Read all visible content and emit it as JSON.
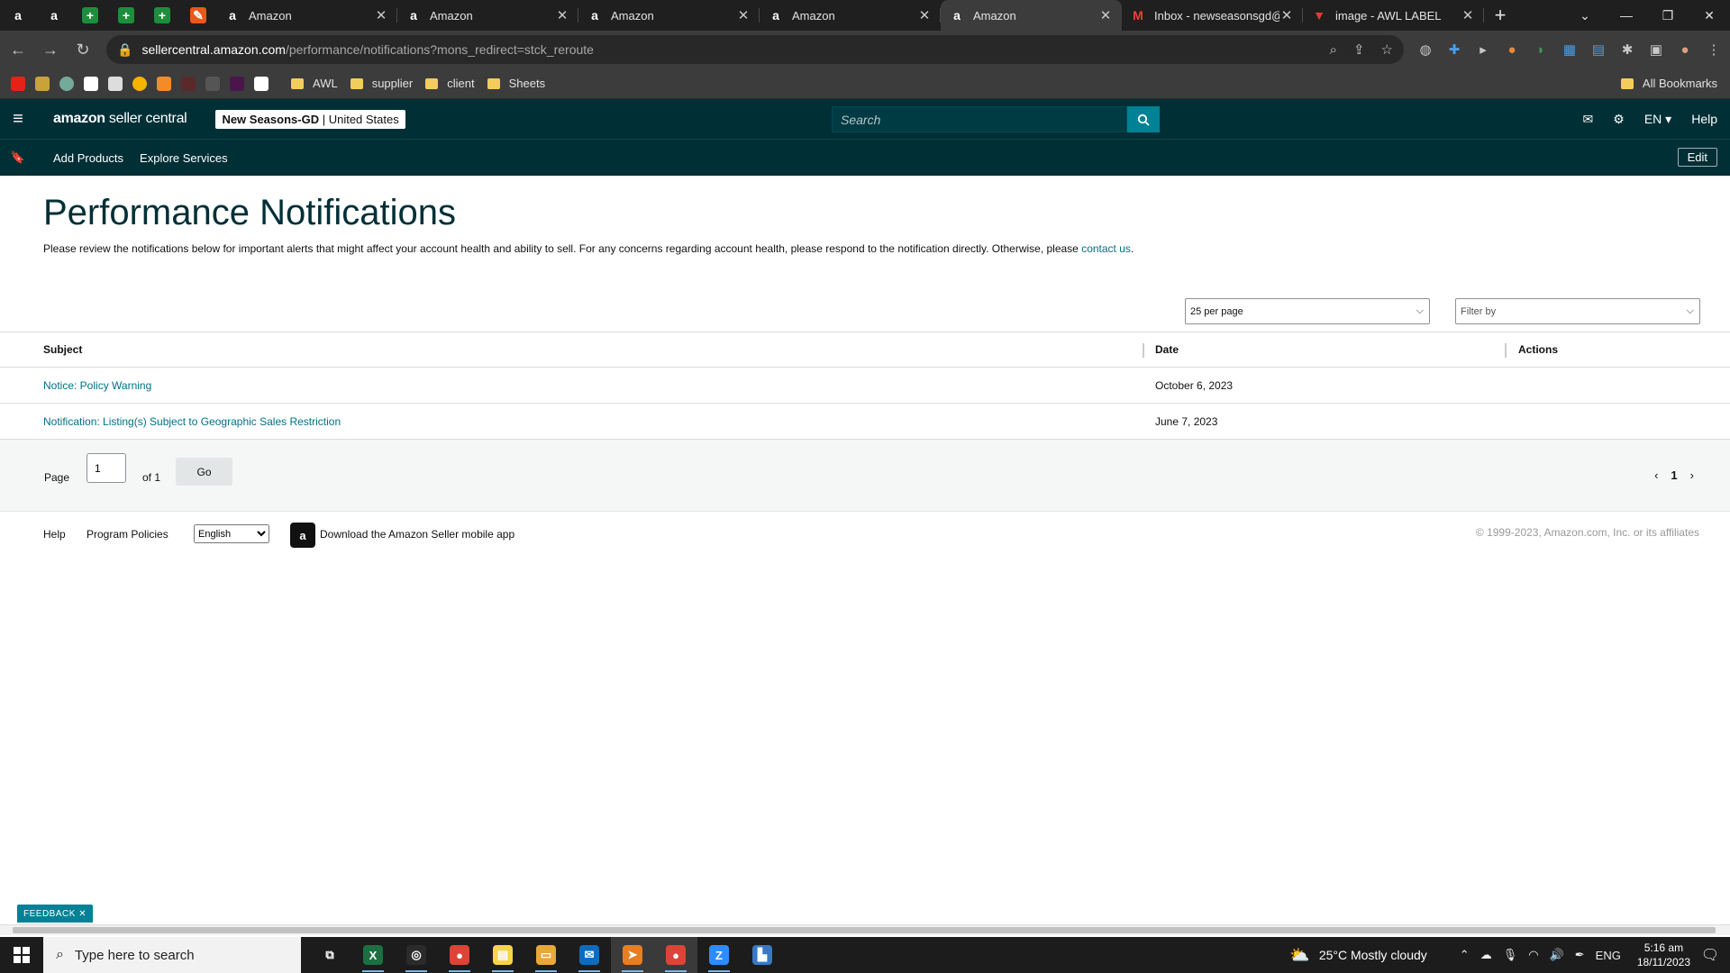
{
  "browser": {
    "pinned_tabs": [
      {
        "icon": "amazon-icon",
        "glyph": "a",
        "bg": "#1f1f1f",
        "fg": "#ffffff"
      },
      {
        "icon": "amazon-icon",
        "glyph": "a",
        "bg": "#1f1f1f",
        "fg": "#ffffff"
      },
      {
        "icon": "sheets-icon",
        "glyph": "+",
        "bg": "#1e8e3e",
        "fg": "#ffffff"
      },
      {
        "icon": "sheets-icon",
        "glyph": "+",
        "bg": "#1e8e3e",
        "fg": "#ffffff"
      },
      {
        "icon": "sheets-icon",
        "glyph": "+",
        "bg": "#1e8e3e",
        "fg": "#ffffff"
      },
      {
        "icon": "tool-icon",
        "glyph": "✎",
        "bg": "#e8591a",
        "fg": "#ffffff"
      }
    ],
    "tabs": [
      {
        "title": "Amazon",
        "active": false
      },
      {
        "title": "Amazon",
        "active": false
      },
      {
        "title": "Amazon",
        "active": false
      },
      {
        "title": "Amazon",
        "active": false
      },
      {
        "title": "Amazon",
        "active": true
      },
      {
        "title": "Inbox - newseasonsgd@",
        "active": false
      },
      {
        "title": "image - AWL LABEL",
        "active": false
      }
    ],
    "url_host": "sellercentral.amazon.com",
    "url_path": "/performance/notifications?mons_redirect=stck_reroute",
    "bookmarks": [
      "AWL",
      "supplier",
      "client",
      "Sheets"
    ],
    "all_bookmarks": "All Bookmarks"
  },
  "header": {
    "logo_bold": "amazon",
    "logo_rest": " seller central",
    "account_name": "New Seasons-GD",
    "account_region": " | United States",
    "search_placeholder": "Search",
    "language": "EN",
    "help": "Help"
  },
  "subnav": {
    "links": [
      "Add Products",
      "Explore Services"
    ],
    "edit": "Edit"
  },
  "page": {
    "title": "Performance Notifications",
    "intro": "Please review the notifications below for important alerts that might affect your account health and ability to sell. For any concerns regarding account health, please respond to the notification directly. Otherwise, please ",
    "contact_link": "contact us",
    "intro_end": ".",
    "per_page": "25 per page",
    "filter": "Filter by",
    "table": {
      "headers": [
        "Subject",
        "Date",
        "Actions"
      ],
      "rows": [
        {
          "subject": "Notice: Policy Warning",
          "date": "October 6, 2023"
        },
        {
          "subject": "Notification: Listing(s) Subject to Geographic Sales Restriction",
          "date": "June 7, 2023"
        }
      ]
    },
    "pagination": {
      "page_label": "Page",
      "page_value": "1",
      "of_label": "of 1",
      "go": "Go",
      "current": "1"
    }
  },
  "footer": {
    "help": "Help",
    "policies": "Program Policies",
    "language": "English",
    "app_text": "Download the Amazon Seller mobile app",
    "copyright": "© 1999-2023, Amazon.com, Inc. or its affiliates"
  },
  "feedback": "FEEDBACK",
  "taskbar": {
    "search_placeholder": "Type here to search",
    "weather": "25°C  Mostly cloudy",
    "lang": "ENG",
    "time": "5:16 am",
    "date": "18/11/2023",
    "apps": [
      {
        "name": "task-view-icon",
        "glyph": "⧉",
        "bg": "transparent"
      },
      {
        "name": "excel-icon",
        "glyph": "X",
        "bg": "#1d6f42"
      },
      {
        "name": "obs-icon",
        "glyph": "◎",
        "bg": "#2b2b2b"
      },
      {
        "name": "chrome-icon",
        "glyph": "●",
        "bg": "#db4437"
      },
      {
        "name": "sticky-notes-icon",
        "glyph": "▤",
        "bg": "#f7d44c"
      },
      {
        "name": "file-explorer-icon",
        "glyph": "▭",
        "bg": "#e6a93a"
      },
      {
        "name": "mail-icon",
        "glyph": "✉",
        "bg": "#0f6cbd"
      },
      {
        "name": "telegram-icon",
        "glyph": "➤",
        "bg": "#e67e22"
      },
      {
        "name": "chrome-icon",
        "glyph": "●",
        "bg": "#db4437"
      },
      {
        "name": "zoom-icon",
        "glyph": "Z",
        "bg": "#2d8cff"
      },
      {
        "name": "files-icon",
        "glyph": "▙",
        "bg": "#3a78c4"
      }
    ]
  }
}
